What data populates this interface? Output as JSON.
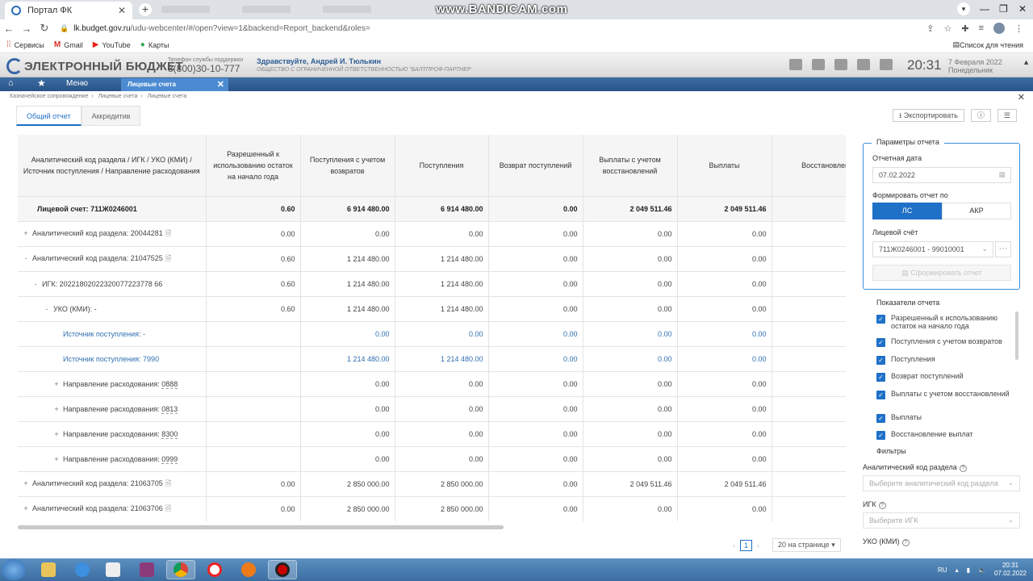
{
  "browser": {
    "tab_title": "Портал ФК",
    "tab_close": "✕",
    "new_tab": "+",
    "watermark": "www.BANDICAM.com",
    "url_host": "lk.budget.gov.ru",
    "url_rest": "/udu-webcenter/#/open?view=1&backend=Report_backend&roles=",
    "bookmarks": [
      {
        "label": "Сервисы"
      },
      {
        "label": "Gmail"
      },
      {
        "label": "YouTube"
      },
      {
        "label": "Карты"
      }
    ],
    "reading_list": "Список для чтения"
  },
  "header": {
    "logo_text": "ЭЛЕКТРОННЫЙ БЮДЖЕТ",
    "support_label": "Телефон службы поддержки",
    "support_phone": "8(800)30-10-777",
    "greeting": "Здравствуйте, Андрей И. Тюлькин",
    "organization": "ОБЩЕСТВО С ОГРАНИЧЕННОЙ ОТВЕТСТВЕННОСТЬЮ \"БАЛТПРОФ-ПАРТНЕР",
    "time": "20:31",
    "date_line1": "7 Февраля 2022",
    "date_line2": "Понедельник"
  },
  "menubar": {
    "menu_label": "Меню",
    "open_tab": "Лицевые счета"
  },
  "breadcrumbs": [
    "Казначейское сопровождение",
    "Лицевые счета",
    "Лицевые счета"
  ],
  "report_tabs": [
    {
      "label": "Общий отчет",
      "active": true
    },
    {
      "label": "Аккредитив",
      "active": false
    }
  ],
  "toolbar": {
    "export_label": "Экспортировать"
  },
  "table": {
    "headers": [
      "Аналитический код раздела / ИГК / УКО (КМИ) / Источник поступления / Направление расходования",
      "Разрешенный к использованию остаток на начало года",
      "Поступления с учетом возвратов",
      "Поступления",
      "Возврат поступлений",
      "Выплаты с учетом восстановлений",
      "Выплаты",
      "Восстановление выплат"
    ],
    "total": {
      "label": "Лицевой счет: 711Ж0246001",
      "values": [
        "0.60",
        "6 914 480.00",
        "6 914 480.00",
        "0.00",
        "2 049 511.46",
        "2 049 511.46",
        ""
      ]
    },
    "rows": [
      {
        "toggle": "+",
        "level": 0,
        "label": "Аналитический код раздела:",
        "code": "20044281",
        "doc": true,
        "link": false,
        "values": [
          "0.00",
          "0.00",
          "0.00",
          "0.00",
          "0.00",
          "0.00",
          ""
        ]
      },
      {
        "toggle": "-",
        "level": 0,
        "label": "Аналитический код раздела:",
        "code": "21047525",
        "doc": true,
        "link": false,
        "values": [
          "0.60",
          "1 214 480.00",
          "1 214 480.00",
          "0.00",
          "0.00",
          "0.00",
          ""
        ]
      },
      {
        "toggle": "-",
        "level": 1,
        "label": "ИГК:",
        "code": "20221802022320077223778 66",
        "doc": false,
        "link": false,
        "values": [
          "0.60",
          "1 214 480.00",
          "1 214 480.00",
          "0.00",
          "0.00",
          "0.00",
          ""
        ]
      },
      {
        "toggle": "-",
        "level": 2,
        "label": "УКО (КМИ):",
        "code": "-",
        "doc": false,
        "link": false,
        "values": [
          "0.60",
          "1 214 480.00",
          "1 214 480.00",
          "0.00",
          "0.00",
          "0.00",
          ""
        ]
      },
      {
        "toggle": "",
        "level": 3,
        "label": "Источник поступления:",
        "code": "-",
        "doc": false,
        "link": true,
        "values": [
          "",
          "0.00",
          "0.00",
          "0.00",
          "0.00",
          "0.00",
          ""
        ]
      },
      {
        "toggle": "",
        "level": 3,
        "label": "Источник поступления:",
        "code": "7990",
        "doc": false,
        "link": true,
        "values": [
          "",
          "1 214 480.00",
          "1 214 480.00",
          "0.00",
          "0.00",
          "0.00",
          ""
        ]
      },
      {
        "toggle": "+",
        "level": 3,
        "label": "Направление расходования:",
        "code": "0888",
        "doc": false,
        "link": false,
        "values": [
          "",
          "0.00",
          "0.00",
          "0.00",
          "0.00",
          "0.00",
          ""
        ]
      },
      {
        "toggle": "+",
        "level": 3,
        "label": "Направление расходования:",
        "code": "0813",
        "doc": false,
        "link": false,
        "values": [
          "",
          "0.00",
          "0.00",
          "0.00",
          "0.00",
          "0.00",
          ""
        ]
      },
      {
        "toggle": "+",
        "level": 3,
        "label": "Направление расходования:",
        "code": "8300",
        "doc": false,
        "link": false,
        "values": [
          "",
          "0.00",
          "0.00",
          "0.00",
          "0.00",
          "0.00",
          ""
        ]
      },
      {
        "toggle": "+",
        "level": 3,
        "label": "Направление расходования:",
        "code": "0999",
        "doc": false,
        "link": false,
        "values": [
          "",
          "0.00",
          "0.00",
          "0.00",
          "0.00",
          "0.00",
          ""
        ]
      },
      {
        "toggle": "+",
        "level": 0,
        "label": "Аналитический код раздела:",
        "code": "21063705",
        "doc": true,
        "link": false,
        "values": [
          "0.00",
          "2 850 000.00",
          "2 850 000.00",
          "0.00",
          "2 049 511.46",
          "2 049 511.46",
          ""
        ]
      },
      {
        "toggle": "+",
        "level": 0,
        "label": "Аналитический код раздела:",
        "code": "21063706",
        "doc": true,
        "link": false,
        "values": [
          "0.00",
          "2 850 000.00",
          "2 850 000.00",
          "0.00",
          "0.00",
          "0.00",
          ""
        ]
      }
    ]
  },
  "pager": {
    "current": "1",
    "per_page": "20 на странице"
  },
  "params": {
    "title": "Параметры отчета",
    "date_label": "Отчетная дата",
    "date_value": "07.02.2022",
    "form_by_label": "Формировать отчет по",
    "options": [
      "ЛС",
      "АКР"
    ],
    "account_label": "Лицевой счёт",
    "account_value": "711Ж0246001 - 99010001",
    "generate_label": "Сформировать отчет"
  },
  "indicators": {
    "title": "Показатели отчета",
    "items": [
      "Разрешенный к использованию остаток на начало года",
      "Поступления с учетом возвратов",
      "Поступления",
      "Возврат поступлений",
      "Выплаты с учетом восстановлений",
      "Выплаты",
      "Восстановление выплат"
    ]
  },
  "filters": {
    "title": "Фильтры",
    "section_code_label": "Аналитический код раздела",
    "section_code_placeholder": "Выберите аналитический код раздела",
    "igk_label": "ИГК",
    "igk_placeholder": "Выберите ИГК",
    "uko_label": "УКО (КМИ)"
  },
  "taskbar": {
    "lang": "RU",
    "time": "20:31",
    "date": "07.02.2022"
  },
  "colors": {
    "accent": "#1f70c7",
    "menubar": "#2c5486"
  }
}
